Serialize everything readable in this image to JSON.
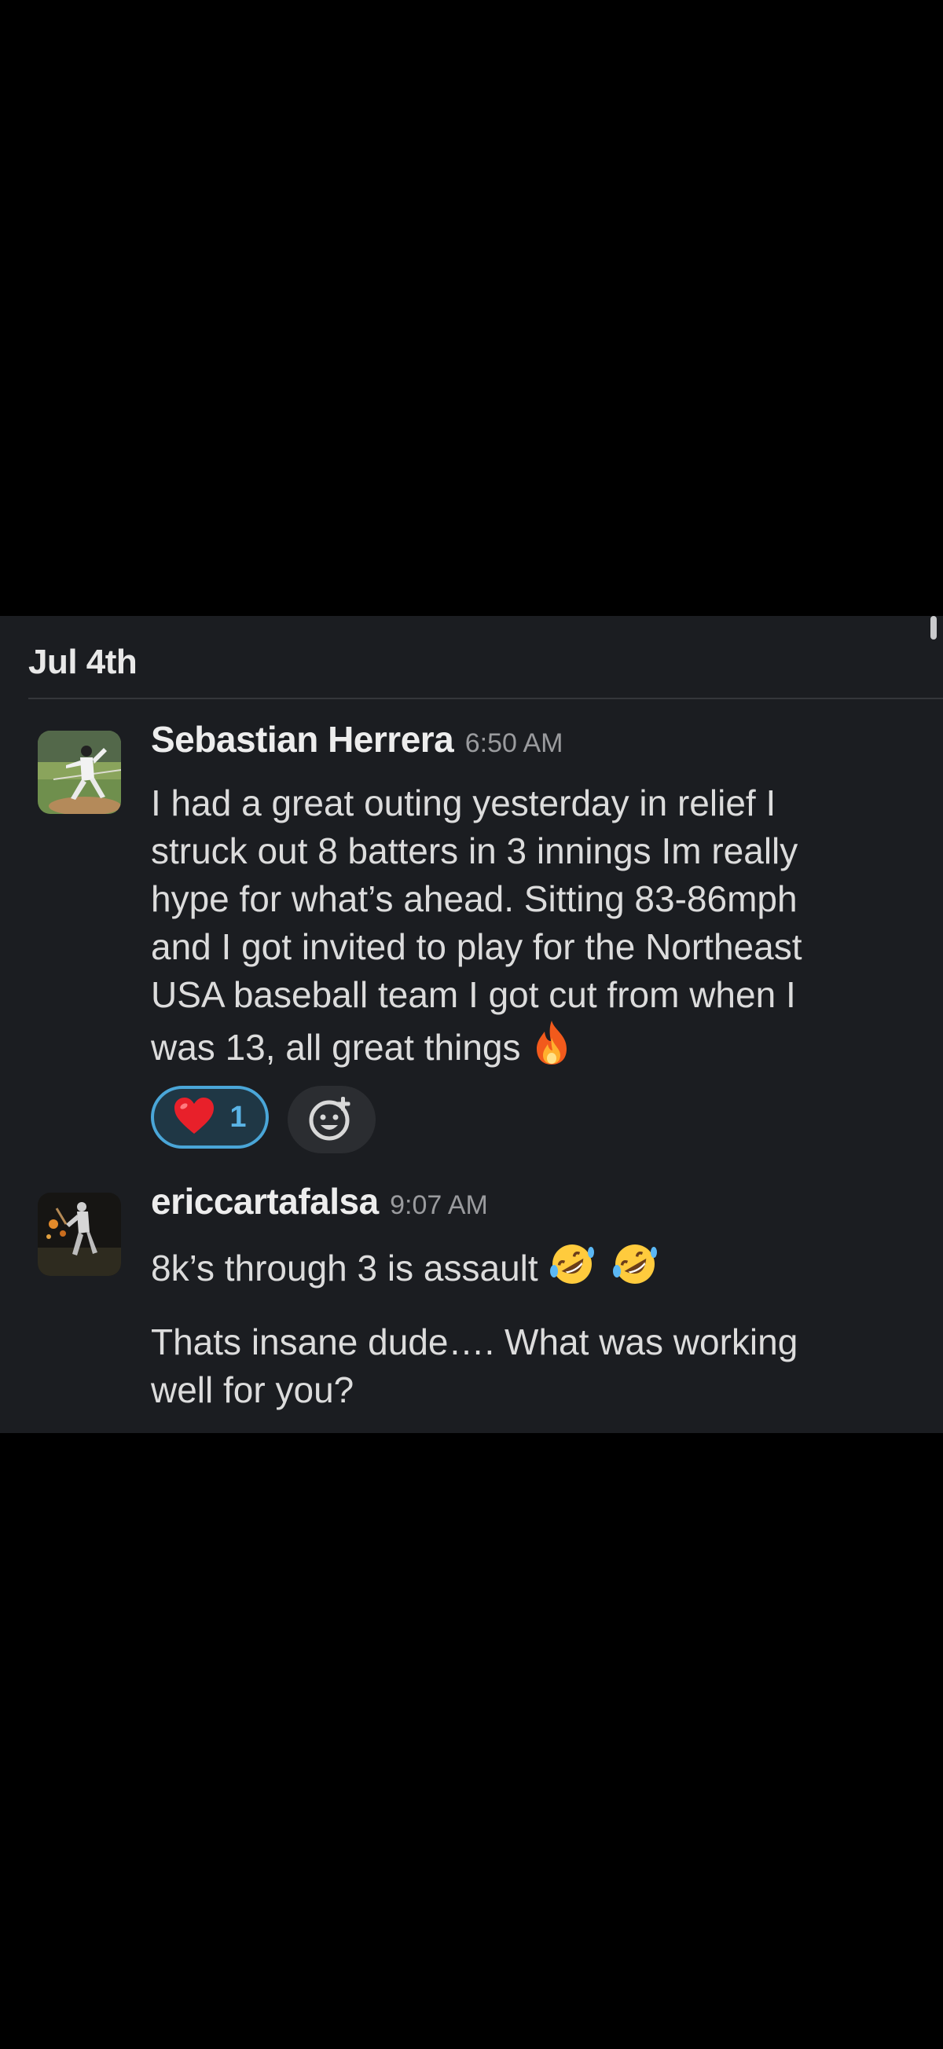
{
  "date_header": "Jul 4th",
  "messages": [
    {
      "author": "Sebastian Herrera",
      "time": "6:50 AM",
      "lines": [
        "I had a great outing yesterday in relief I",
        "struck out 8 batters in 3 innings Im really",
        "hype for what’s ahead. Sitting 83-86mph",
        "and I got invited to play for the Northeast",
        "USA baseball team I got cut from when I",
        "was 13, all great things"
      ],
      "inline_emoji": "fire-emoji",
      "reactions": [
        {
          "emoji": "heart-emoji",
          "count": "1"
        }
      ],
      "add_reaction_icon": "add-reaction-icon"
    },
    {
      "author": "ericcartafalsa",
      "time": "9:07 AM",
      "lines": [
        "8k’s through 3 is assault"
      ],
      "inline_emojis": [
        "rolling-on-floor-laughing-emoji",
        "rolling-on-floor-laughing-emoji"
      ],
      "followup_lines": [
        "Thats insane dude…. What was working",
        "well for you?"
      ]
    }
  ],
  "colors": {
    "panel_bg": "#1b1d21",
    "reaction_border": "#4aa6d8",
    "reaction_count": "#5ab4e6"
  }
}
